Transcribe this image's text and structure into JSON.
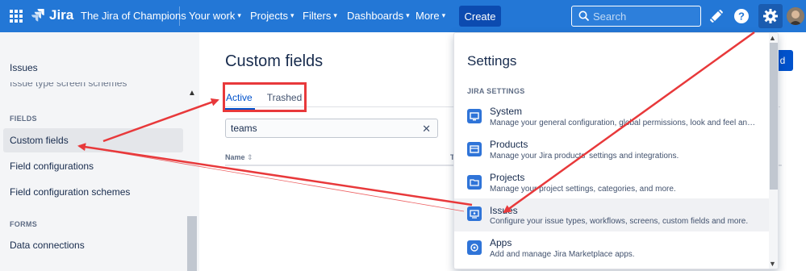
{
  "topnav": {
    "logo_text": "Jira",
    "site_name": "The Jira of Champions",
    "items": [
      {
        "label": "Your work"
      },
      {
        "label": "Projects"
      },
      {
        "label": "Filters"
      },
      {
        "label": "Dashboards"
      },
      {
        "label": "More"
      }
    ],
    "create_label": "Create",
    "search_placeholder": "Search",
    "icons": [
      "apps-grid-icon",
      "jira-logo-icon",
      "notification-icon",
      "help-icon",
      "gear-icon",
      "avatar"
    ]
  },
  "sidebar": {
    "title": "Issues",
    "cut_item": "Issue type screen schemes",
    "sections": [
      {
        "header": "FIELDS",
        "items": [
          {
            "label": "Custom fields",
            "active": true
          },
          {
            "label": "Field configurations"
          },
          {
            "label": "Field configuration schemes"
          }
        ]
      },
      {
        "header": "FORMS",
        "items": [
          {
            "label": "Data connections"
          }
        ]
      }
    ]
  },
  "main": {
    "title": "Custom fields",
    "tabs": [
      {
        "label": "Active",
        "active": true
      },
      {
        "label": "Trashed"
      }
    ],
    "filter_value": "teams",
    "columns": {
      "name": "Name",
      "second": "T"
    },
    "add_button_label": "d"
  },
  "settings_menu": {
    "title": "Settings",
    "section": "JIRA SETTINGS",
    "items": [
      {
        "name": "System",
        "desc": "Manage your general configuration, global permissions, look and feel and more.",
        "icon": "system-icon"
      },
      {
        "name": "Products",
        "desc": "Manage your Jira products' settings and integrations.",
        "icon": "products-icon"
      },
      {
        "name": "Projects",
        "desc": "Manage your project settings, categories, and more.",
        "icon": "projects-icon"
      },
      {
        "name": "Issues",
        "desc": "Configure your issue types, workflows, screens, custom fields and more.",
        "icon": "issues-icon",
        "active": true
      },
      {
        "name": "Apps",
        "desc": "Add and manage Jira Marketplace apps.",
        "icon": "apps-icon"
      }
    ]
  },
  "colors": {
    "nav_bg": "#2377d6",
    "create_bg": "#0c4bb0",
    "accent": "#0052cc",
    "annotation_red": "#e8393b"
  }
}
